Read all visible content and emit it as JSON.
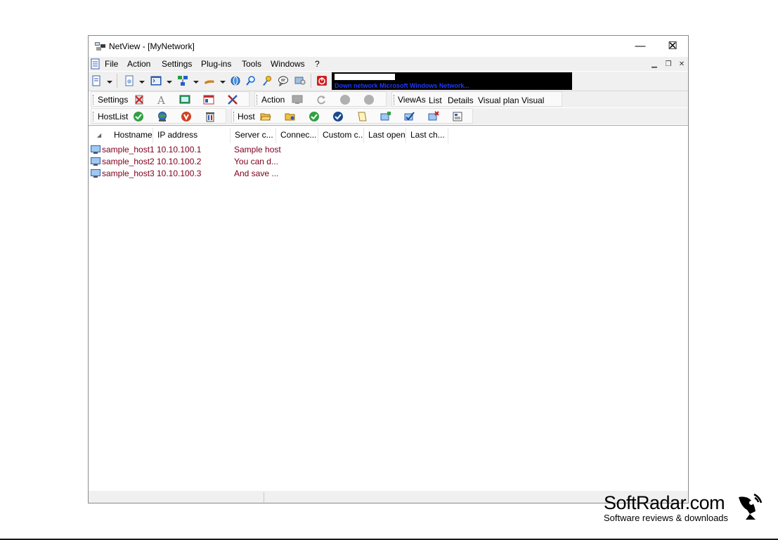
{
  "window": {
    "title": "NetView - [MyNetwork]",
    "minimize_glyph": "—",
    "maximize_glyph": "☐",
    "close_glyph": "✕"
  },
  "menu": {
    "items": [
      "File",
      "Action",
      "Settings",
      "Plug-ins",
      "Tools",
      "Windows",
      "?"
    ]
  },
  "banner": {
    "scroll_text": "Down network Microsoft Windows Network..."
  },
  "toolbar_settings": {
    "label": "Settings"
  },
  "toolbar_action": {
    "label": "Action"
  },
  "toolbar_viewas": {
    "label": "ViewAs",
    "options": [
      "List",
      "Details",
      "Visual plan",
      "Visual map"
    ]
  },
  "toolbar_hostlist": {
    "label": "HostList"
  },
  "toolbar_host": {
    "label": "Host"
  },
  "list": {
    "columns": [
      "Hostname",
      "IP address",
      "Server c...",
      "Connec...",
      "Custom c...",
      "Last open",
      "Last ch..."
    ],
    "rows": [
      {
        "hostname": "sample_host1",
        "ip": "10.10.100.1",
        "comment": "Sample host"
      },
      {
        "hostname": "sample_host2",
        "ip": "10.10.100.2",
        "comment": "You can d..."
      },
      {
        "hostname": "sample_host3",
        "ip": "10.10.100.3",
        "comment": "And save ..."
      }
    ]
  },
  "watermark": {
    "name": "SoftRadar.com",
    "tagline": "Software reviews & downloads"
  },
  "colors": {
    "row_text": "#800020",
    "banner_text": "#2038ff",
    "toolbar_bg": "#f0f0f0"
  },
  "icons": [
    "netview-app-icon",
    "document-icon",
    "new-icon",
    "console-icon",
    "network-icon",
    "pipe-icon",
    "globe-icon",
    "search-icon",
    "key-icon",
    "message-icon",
    "tools-icon",
    "power-icon",
    "delete-icon",
    "font-icon",
    "display-icon",
    "window-icon",
    "wrench-icon",
    "monitor-icon",
    "refresh-icon",
    "stop-icon",
    "check-icon",
    "globe-add-icon",
    "shield-icon",
    "trash-icon",
    "folder-open-icon",
    "folder-icon",
    "check-blue-icon",
    "note-icon",
    "host-add-icon",
    "host-edit-icon",
    "host-delete-icon",
    "properties-icon",
    "satellite-icon"
  ]
}
